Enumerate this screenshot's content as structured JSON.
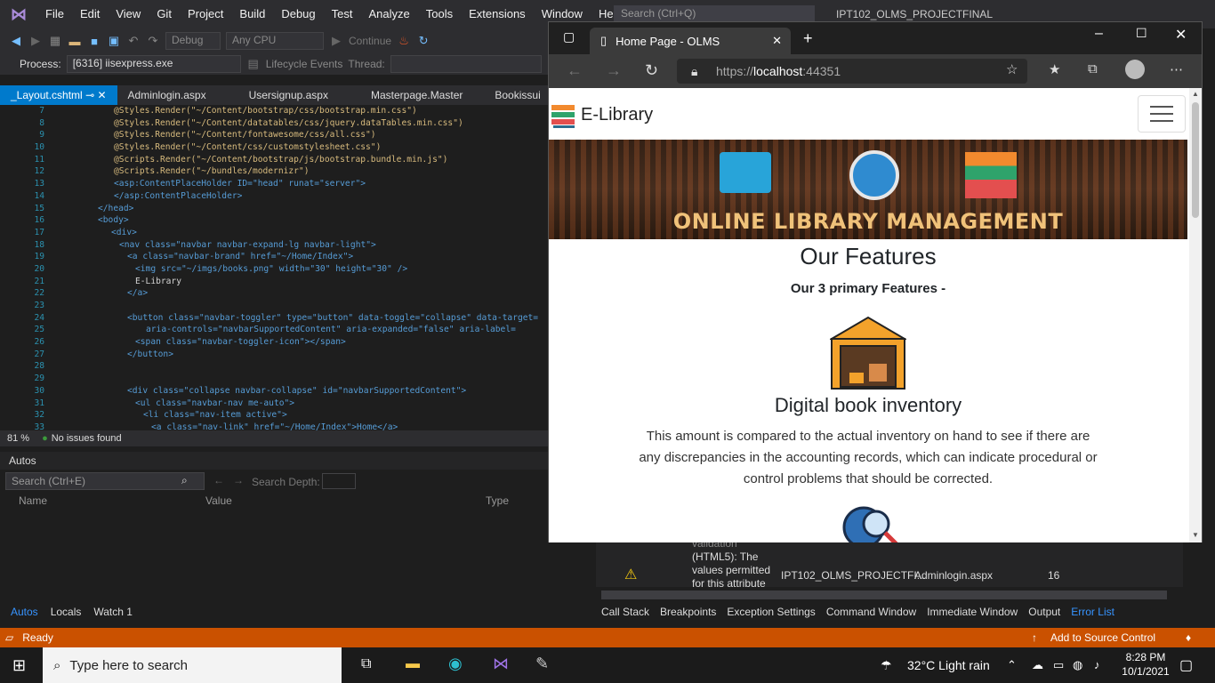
{
  "vs": {
    "menu": [
      "File",
      "Edit",
      "View",
      "Git",
      "Project",
      "Build",
      "Debug",
      "Test",
      "Analyze",
      "Tools",
      "Extensions",
      "Window",
      "Help"
    ],
    "search_placeholder": "Search (Ctrl+Q)",
    "solution_name": "IPT102_OLMS_PROJECTFINAL",
    "toolbar": {
      "config": "Debug",
      "platform": "Any CPU",
      "continue": "Continue"
    },
    "process_label": "Process:",
    "process_value": "[6316] iisexpress.exe",
    "lifecycle": "Lifecycle Events",
    "thread_label": "Thread:",
    "tabs": [
      "_Layout.cshtml",
      "Adminlogin.aspx",
      "Usersignup.aspx",
      "Masterpage.Master",
      "Bookissui"
    ],
    "code_lines": [
      {
        "n": "7",
        "t": "@Styles.Render(\"~/Content/bootstrap/css/bootstrap.min.css\")"
      },
      {
        "n": "8",
        "t": "@Styles.Render(\"~/Content/datatables/css/jquery.dataTables.min.css\")"
      },
      {
        "n": "9",
        "t": "@Styles.Render(\"~/Content/fontawesome/css/all.css\")"
      },
      {
        "n": "10",
        "t": "@Styles.Render(\"~/Content/css/customstylesheet.css\")"
      },
      {
        "n": "11",
        "t": "@Scripts.Render(\"~/Content/bootstrap/js/bootstrap.bundle.min.js\")"
      },
      {
        "n": "12",
        "t": "@Scripts.Render(\"~/bundles/modernizr\")"
      },
      {
        "n": "13",
        "t": "<asp:ContentPlaceHolder ID=\"head\" runat=\"server\">"
      },
      {
        "n": "14",
        "t": "</asp:ContentPlaceHolder>"
      },
      {
        "n": "15",
        "t": "</head>"
      },
      {
        "n": "16",
        "t": "<body>"
      },
      {
        "n": "17",
        "t": "<div>"
      },
      {
        "n": "18",
        "t": "<nav class=\"navbar navbar-expand-lg navbar-light\">"
      },
      {
        "n": "19",
        "t": "<a class=\"navbar-brand\" href=\"~/Home/Index\">"
      },
      {
        "n": "20",
        "t": "<img src=\"~/imgs/books.png\" width=\"30\" height=\"30\" />"
      },
      {
        "n": "21",
        "t": "E-Library"
      },
      {
        "n": "22",
        "t": "</a>"
      },
      {
        "n": "23",
        "t": ""
      },
      {
        "n": "24",
        "t": "<button class=\"navbar-toggler\" type=\"button\" data-toggle=\"collapse\" data-target="
      },
      {
        "n": "25",
        "t": "aria-controls=\"navbarSupportedContent\" aria-expanded=\"false\" aria-label="
      },
      {
        "n": "26",
        "t": "<span class=\"navbar-toggler-icon\"></span>"
      },
      {
        "n": "27",
        "t": "</button>"
      },
      {
        "n": "28",
        "t": ""
      },
      {
        "n": "29",
        "t": ""
      },
      {
        "n": "30",
        "t": "<div class=\"collapse navbar-collapse\" id=\"navbarSupportedContent\">"
      },
      {
        "n": "31",
        "t": "<ul class=\"navbar-nav me-auto\">"
      },
      {
        "n": "32",
        "t": "<li class=\"nav-item active\">"
      },
      {
        "n": "33",
        "t": "<a class=\"nav-link\" href=\"~/Home/Index\">Home</a>"
      }
    ],
    "zoom": "81 %",
    "issues": "No issues found",
    "autos": {
      "title": "Autos",
      "search_placeholder": "Search (Ctrl+E)",
      "depth_label": "Search Depth:",
      "columns": [
        "Name",
        "Value",
        "Type"
      ],
      "tabs": [
        "Autos",
        "Locals",
        "Watch 1"
      ]
    },
    "error_row": {
      "text_line1": "validation",
      "text_line2": "(HTML5): The",
      "text_line3": "values permitted",
      "text_line4": "for this attribute",
      "project": "IPT102_OLMS_PROJECTFI...",
      "file": "Adminlogin.aspx",
      "line": "16"
    },
    "bottom_tabs": [
      "Call Stack",
      "Breakpoints",
      "Exception Settings",
      "Command Window",
      "Immediate Window",
      "Output",
      "Error List"
    ],
    "status": {
      "ready": "Ready",
      "source_control": "Add to Source Control"
    }
  },
  "browser": {
    "tab_title": "Home Page - OLMS",
    "url_scheme": "https://",
    "url_host": "localhost",
    "url_port": ":44351",
    "page": {
      "brand": "E-Library",
      "banner_text": "ONLINE LIBRARY MANAGEMENT",
      "heading": "Our Features",
      "subheading": "Our 3 primary Features -",
      "feature_title": "Digital book inventory",
      "feature_text": "This amount is compared to the actual inventory on hand to see if there are any discrepancies in the accounting records, which can indicate procedural or control problems that should be corrected."
    }
  },
  "taskbar": {
    "search_placeholder": "Type here to search",
    "weather": "32°C  Light rain",
    "time": "8:28 PM",
    "date": "10/1/2021"
  },
  "colors": {
    "vs_accent": "#007acc",
    "status_bar": "#ca5100",
    "banner_text": "#f0c27a"
  }
}
